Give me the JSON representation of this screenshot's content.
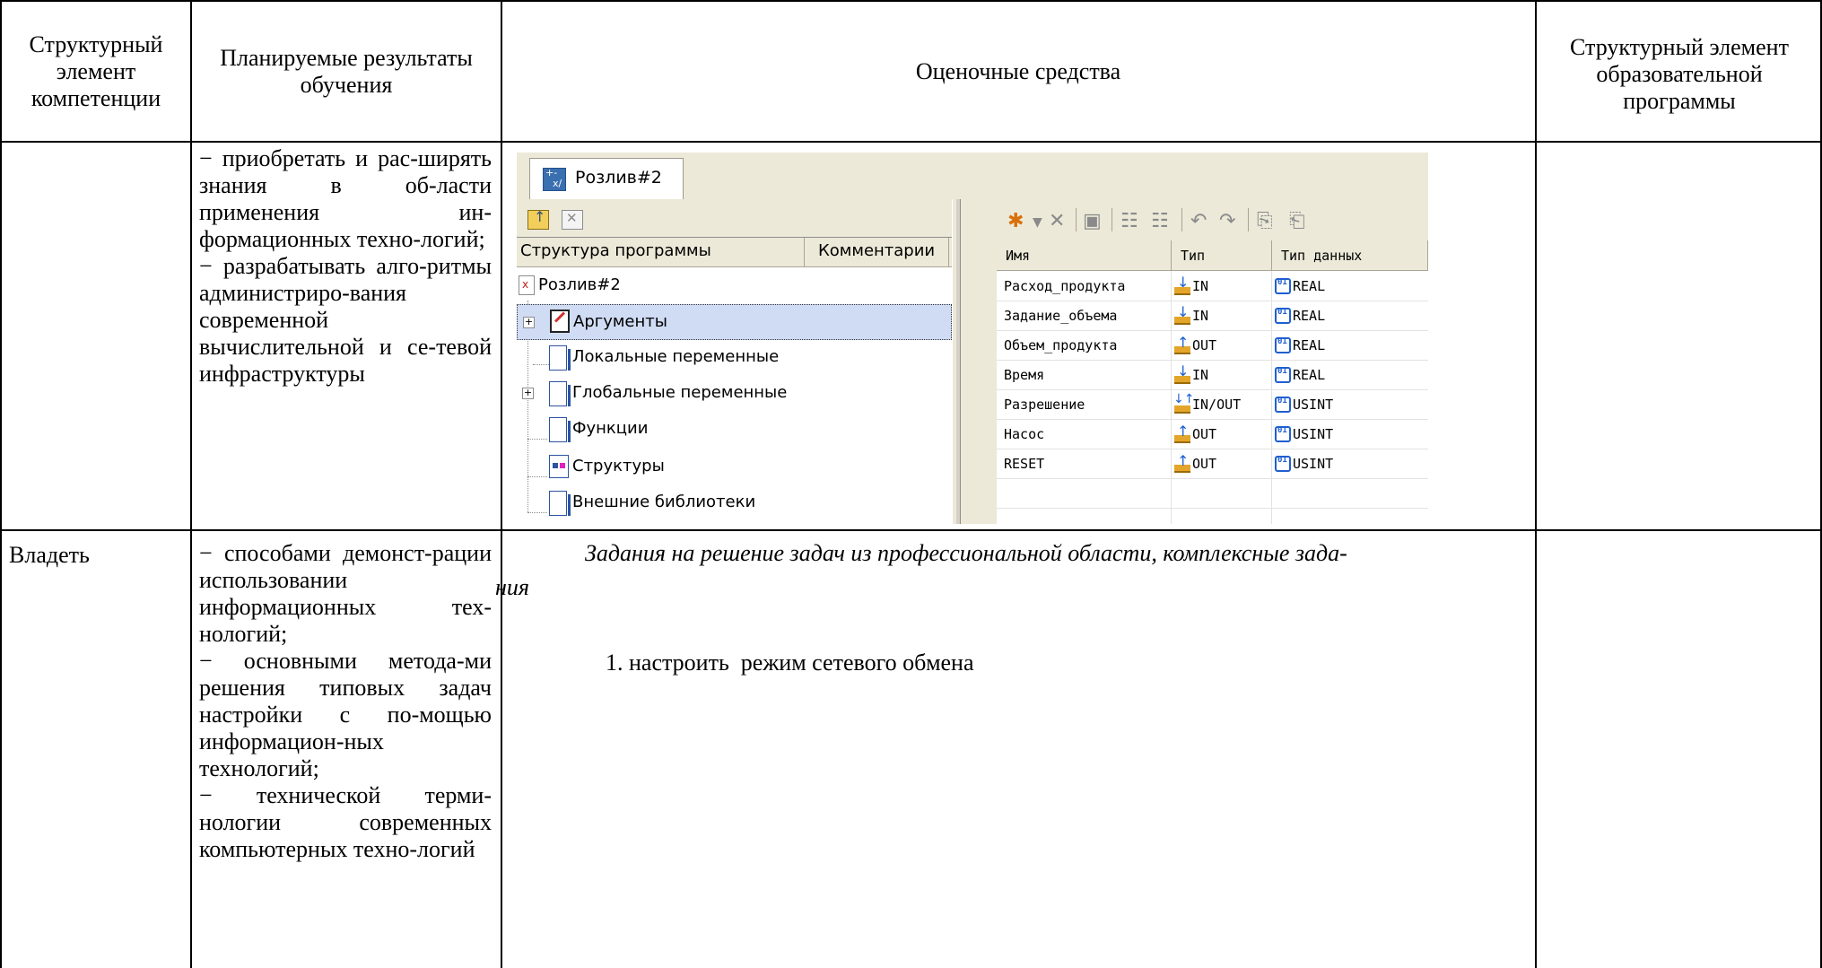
{
  "header": {
    "col1": "Структурный элемент компетенции",
    "col2": "Планируемые результаты обучения",
    "col3": "Оценочные средства",
    "col4": "Структурный элемент образовательной программы"
  },
  "row1": {
    "results": [
      "− приобретать и рас-ширять знания в об-ласти применения ин-формационных техно-логий;",
      "− разрабатывать алго-ритмы администриро-вания современной вычислительной и се-тевой инфраструктуры"
    ],
    "screenshot": {
      "tab_title": "Розлив#2",
      "tree_header": {
        "structure": "Структура программы",
        "comments": "Комментарии"
      },
      "tree": [
        "Розлив#2",
        "Аргументы",
        "Локальные переменные",
        "Глобальные переменные",
        "Функции",
        "Структуры",
        "Внешние библиотеки"
      ],
      "grid_header": {
        "name": "Имя",
        "type": "Тип",
        "data_type": "Тип данных"
      },
      "grid_rows": [
        {
          "name": "Расход_продукта",
          "type": "IN",
          "data_type": "REAL",
          "dir_icon": "input-arrow-icon"
        },
        {
          "name": "Задание_объема",
          "type": "IN",
          "data_type": "REAL",
          "dir_icon": "input-arrow-icon"
        },
        {
          "name": "Объем_продукта",
          "type": "OUT",
          "data_type": "REAL",
          "dir_icon": "output-arrow-icon"
        },
        {
          "name": "Время",
          "type": "IN",
          "data_type": "REAL",
          "dir_icon": "input-arrow-icon"
        },
        {
          "name": "Разрешение",
          "type": "IN/OUT",
          "data_type": "USINT",
          "dir_icon": "inout-arrow-icon"
        },
        {
          "name": "Насос",
          "type": "OUT",
          "data_type": "USINT",
          "dir_icon": "output-arrow-icon"
        },
        {
          "name": "RESET",
          "type": "OUT",
          "data_type": "USINT",
          "dir_icon": "output-arrow-icon"
        }
      ]
    }
  },
  "row2": {
    "element": "Владеть",
    "results": [
      "− способами демонст-рации использовании информационных тех-нологий;",
      "− основными метода-ми решения типовых задач настройки с по-мощью информацион-ных технологий;",
      "− технической терми-нологии современных компьютерных техно-логий"
    ],
    "task_line1": "Задания на решение задач из профессиональной области, комплексные зада-",
    "task_line2": "ния",
    "task_item": "1. настроить  режим сетевого обмена"
  }
}
